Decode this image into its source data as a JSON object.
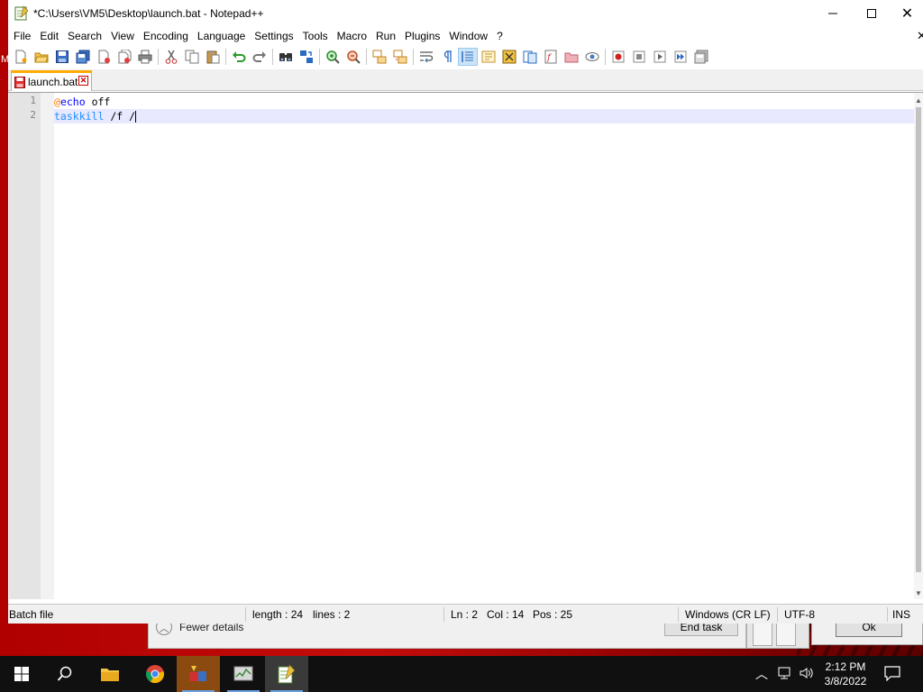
{
  "desktop": {
    "task_manager": {
      "fewer_details_label": "Fewer details",
      "end_task_label": "End task"
    },
    "dialog": {
      "ok_label": "Ok"
    },
    "edge_letter": "M"
  },
  "window": {
    "title": "*C:\\Users\\VM5\\Desktop\\launch.bat - Notepad++",
    "close_glyph": "✕",
    "menu": [
      "File",
      "Edit",
      "Search",
      "View",
      "Encoding",
      "Language",
      "Settings",
      "Tools",
      "Macro",
      "Run",
      "Plugins",
      "Window",
      "?"
    ],
    "menu_close_glyph": "✕"
  },
  "toolbar": {
    "icons": [
      "new-file-icon",
      "open-file-icon",
      "save-icon",
      "save-all-icon",
      "close-icon",
      "close-all-icon",
      "print-icon",
      "cut-icon",
      "copy-icon",
      "paste-icon",
      "undo-icon",
      "redo-icon",
      "find-icon",
      "replace-icon",
      "zoom-in-icon",
      "zoom-out-icon",
      "sync-vertical-icon",
      "sync-horizontal-icon",
      "word-wrap-icon",
      "show-all-chars-icon",
      "indent-guide-icon",
      "user-defined-language-icon",
      "document-map-icon",
      "document-list-icon",
      "function-list-icon",
      "folder-as-workspace-icon",
      "monitoring-icon",
      "record-macro-icon",
      "stop-recording-icon",
      "playback-macro-icon",
      "run-macro-multiple-icon",
      "save-macro-icon"
    ]
  },
  "tab": {
    "label": "launch.bat"
  },
  "editor": {
    "lines": [
      {
        "number": "1",
        "at": "@",
        "keyword": "echo",
        "rest": " off"
      },
      {
        "number": "2",
        "command": "taskkill",
        "rest": " /f /"
      }
    ]
  },
  "statusbar": {
    "language": "Batch file",
    "length": "length : 24",
    "lines": "lines : 2",
    "ln": "Ln : 2",
    "col": "Col : 14",
    "pos": "Pos : 25",
    "eol": "Windows (CR LF)",
    "encoding": "UTF-8",
    "mode": "INS"
  },
  "taskbar": {
    "clock_time": "2:12 PM",
    "clock_date": "3/8/2022"
  },
  "colors": {
    "desktop_red": "#c40c0c",
    "tab_accent": "#ffaa00",
    "current_line": "#e8e8ff",
    "keyword_blue": "#0000ff",
    "command_blue": "#1e90ff",
    "at_orange": "#ff8000"
  }
}
